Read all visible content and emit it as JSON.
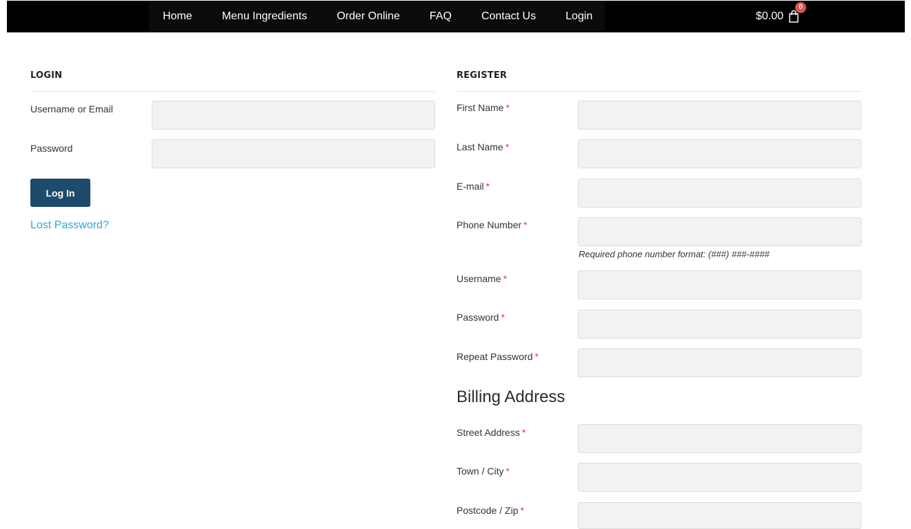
{
  "nav": {
    "items": [
      "Home",
      "Menu Ingredients",
      "Order Online",
      "FAQ",
      "Contact Us",
      "Login"
    ],
    "cart_total": "$0.00",
    "cart_count": "0"
  },
  "login": {
    "heading": "LOGIN",
    "username_label": "Username or Email",
    "password_label": "Password",
    "button_label": "Log In",
    "lost_password": "Lost Password?"
  },
  "register": {
    "heading": "REGISTER",
    "required_mark": "*",
    "first_name_label": "First Name",
    "last_name_label": "Last Name",
    "email_label": "E-mail",
    "phone_label": "Phone Number",
    "phone_hint": "Required phone number format: (###) ###-####",
    "username_label": "Username",
    "password_label": "Password",
    "repeat_password_label": "Repeat Password"
  },
  "billing": {
    "heading": "Billing Address",
    "street_label": "Street Address",
    "city_label": "Town / City",
    "postcode_label": "Postcode / Zip"
  },
  "colors": {
    "topbar": "#000000",
    "button": "#1e4a6b",
    "link": "#2ba8d5",
    "required": "#e2401c",
    "badge": "#d9534f"
  },
  "icons": {
    "cart": "shopping-bag-icon"
  }
}
